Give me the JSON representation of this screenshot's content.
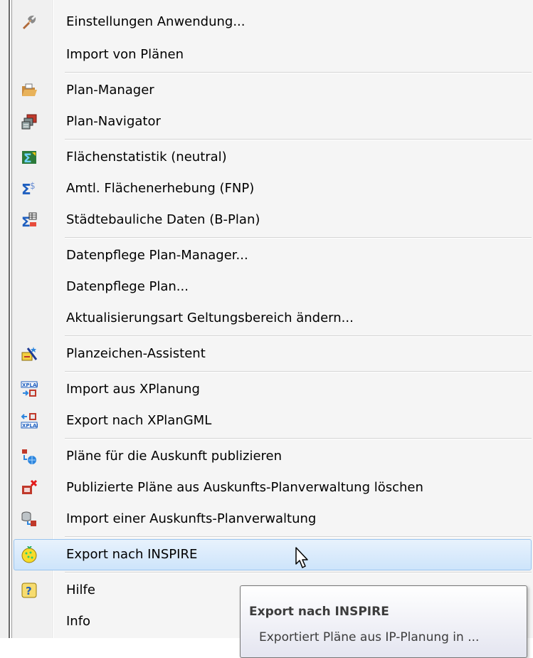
{
  "menu": {
    "items": [
      {
        "label": "Einstellungen Anwendung...",
        "icon": "settings-wrench-icon"
      },
      {
        "label": "Import von Plänen"
      },
      {
        "label": "Plan-Manager",
        "icon": "folder-open-icon"
      },
      {
        "label": "Plan-Navigator",
        "icon": "navigator-windows-icon"
      },
      {
        "label": "Flächenstatistik (neutral)",
        "icon": "sigma-chart-icon"
      },
      {
        "label": "Amtl. Flächenerhebung (FNP)",
        "icon": "sigma-dollar-icon"
      },
      {
        "label": "Städtebauliche Daten (B-Plan)",
        "icon": "sigma-table-icon"
      },
      {
        "label": "Datenpflege Plan-Manager..."
      },
      {
        "label": "Datenpflege Plan..."
      },
      {
        "label": "Aktualisierungsart Geltungsbereich ändern..."
      },
      {
        "label": "Planzeichen-Assistent",
        "icon": "wizard-wand-icon"
      },
      {
        "label": "Import aus XPlanung",
        "icon": "xplan-import-icon"
      },
      {
        "label": "Export nach XPlanGML",
        "icon": "xplan-export-icon"
      },
      {
        "label": "Pläne für die Auskunft publizieren",
        "icon": "publish-globe-icon"
      },
      {
        "label": "Publizierte Pläne aus Auskunfts-Planverwaltung löschen",
        "icon": "delete-box-icon"
      },
      {
        "label": "Import einer Auskunfts-Planverwaltung",
        "icon": "db-import-icon"
      },
      {
        "label": "Export nach INSPIRE",
        "icon": "inspire-globe-icon"
      },
      {
        "label": "Hilfe",
        "icon": "help-icon"
      },
      {
        "label": "Info"
      }
    ]
  },
  "tooltip": {
    "title": "Export nach INSPIRE",
    "body": "Exportiert Pläne aus IP-Planung in ..."
  },
  "colors": {
    "hover_bg": "#cde4fb",
    "hover_border": "#99c4ee"
  }
}
